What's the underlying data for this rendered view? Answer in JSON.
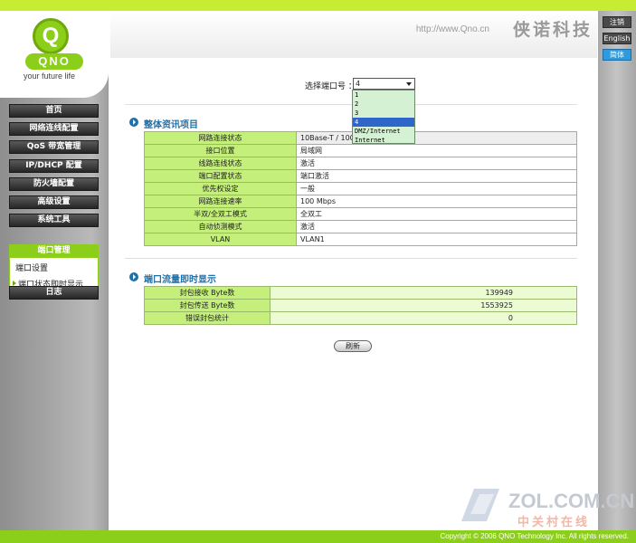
{
  "header": {
    "url": "http://www.Qno.cn",
    "brand": "侠诺科技"
  },
  "logo": {
    "letter": "Q",
    "word": "QNO",
    "tagline": "your future life"
  },
  "menu": {
    "items": [
      "首页",
      "网络连线配置",
      "QoS 带宽管理",
      "IP/DHCP 配置",
      "防火墙配置",
      "高级设置",
      "系统工具"
    ],
    "port_management": {
      "label": "端口管理",
      "sub_items": [
        "端口设置",
        "端口状态即时显示"
      ]
    },
    "log": "日志"
  },
  "right_buttons": {
    "logout": "注销",
    "english": "English",
    "simplified": "简体"
  },
  "port_select": {
    "label": "选择端口号 ：",
    "value": "4",
    "options": [
      "1",
      "2",
      "3",
      "4",
      "DMZ/Internet",
      "Internet"
    ],
    "selected_index": 3
  },
  "overall_section": {
    "title": "整体资讯项目",
    "rows": [
      {
        "key": "网路连接状态",
        "value": "10Base-T / 100"
      },
      {
        "key": "接口位置",
        "value": "局域网"
      },
      {
        "key": "线路连线状态",
        "value": "激活"
      },
      {
        "key": "端口配置状态",
        "value": "端口激活"
      },
      {
        "key": "优先权设定",
        "value": "一般"
      },
      {
        "key": "网路连接速率",
        "value": "100 Mbps"
      },
      {
        "key": "半双/全双工模式",
        "value": "全双工"
      },
      {
        "key": "自动侦测模式",
        "value": "激活"
      },
      {
        "key": "VLAN",
        "value": "VLAN1"
      }
    ]
  },
  "traffic_section": {
    "title": "端口流量即时显示",
    "rows": [
      {
        "key": "封包接收  Byte数",
        "value": "139949"
      },
      {
        "key": "封包传送  Byte数",
        "value": "1553925"
      },
      {
        "key": "错误封包统计",
        "value": "0"
      }
    ]
  },
  "refresh_label": "刷新",
  "footer": {
    "copyright": "Copyright © 2006 QNO Technology Inc. All rights reserved."
  },
  "watermark": {
    "main": "ZOL.COM.CN",
    "sub": "中关村在线"
  }
}
